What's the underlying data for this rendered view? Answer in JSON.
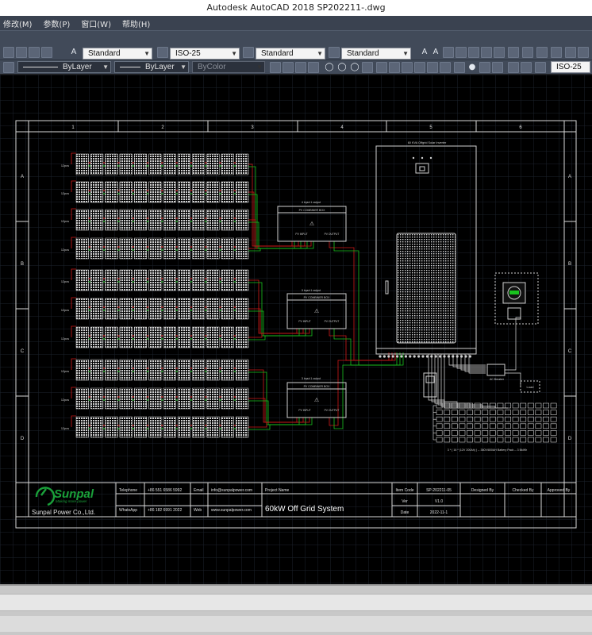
{
  "window": {
    "title": "Autodesk AutoCAD 2018    SP202211-.dwg"
  },
  "menu": {
    "items": [
      "修改(M)",
      "参数(P)",
      "窗口(W)",
      "帮助(H)"
    ]
  },
  "toolbar": {
    "text_style": "Standard",
    "dim_style": "ISO-25",
    "table_style": "Standard",
    "mleader_style": "Standard",
    "layer_linetype": "ByLayer",
    "layer_lineweight": "ByLayer",
    "color": "ByColor",
    "dim_style_right": "ISO-25"
  },
  "drawing": {
    "col_labels": [
      "1",
      "2",
      "3",
      "4",
      "5",
      "6"
    ],
    "row_labels": [
      "A",
      "B",
      "C",
      "D"
    ],
    "string_label": "12pcs",
    "combiner1_title": "4 input 1 output",
    "combiner2_title": "3 input 1 output",
    "combiner3_title": "3 input 1 output",
    "combiner_name": "PV COMBINER BOX",
    "pv_input": "PV INPUT",
    "pv_output": "PV OUTPUT",
    "inverter_title": "60 KVA Offgrid Solar Inverter",
    "ac_breaker": "AC Breaker",
    "load": "Load",
    "battery_note": "3 * ( 16 * (12V 200Ah) ) -- 380V/800AH Battery Pack -- 3 BkWh"
  },
  "title_block": {
    "company_logo": "Sunpal",
    "slogan": "Making more power",
    "company_name": "Sunpal Power Co.,Ltd.",
    "telephone_label": "Telephone",
    "telephone": "+86 551 6586 5992",
    "whatsapp_label": "WhatsApp",
    "whatsapp": "+86 182 6991 2022",
    "email_label": "Email",
    "email": "info@sunpalpower.com",
    "web_label": "Web",
    "web": "www.sunpalpower.com",
    "project_name_label": "Project Name",
    "project_name": "60kW Off Grid System",
    "item_code_label": "Item Code",
    "item_code": "SP-202211-05",
    "ver_label": "Ver",
    "ver": "V1.0",
    "date_label": "Date",
    "date": "2022-11-1",
    "designed_by": "Designed By",
    "checked_by": "Checked By",
    "approved_by": "Approved By"
  },
  "colors": {
    "bg": "#000000",
    "frame": "#d8d8d8",
    "grid": "#1c2430",
    "red": "#d01818",
    "green": "#19c21e",
    "logo_green": "#1aa13a"
  }
}
